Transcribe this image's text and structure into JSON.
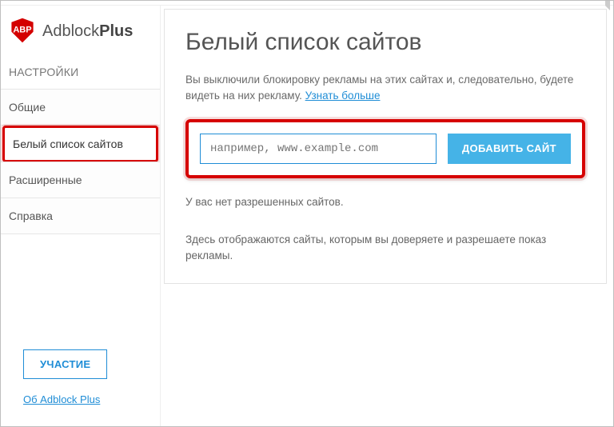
{
  "brand": {
    "name_light": "Adblock",
    "name_bold": "Plus"
  },
  "sidebar": {
    "header": "НАСТРОЙКИ",
    "items": [
      {
        "label": "Общие"
      },
      {
        "label": "Белый список сайтов"
      },
      {
        "label": "Расширенные"
      },
      {
        "label": "Справка"
      }
    ],
    "contribute_label": "УЧАСТИЕ",
    "about_label": "Об Adblock Plus"
  },
  "main": {
    "title": "Белый список сайтов",
    "description_prefix": "Вы выключили блокировку рекламы на этих сайтах и, следовательно, будете видеть на них рекламу. ",
    "learn_more": "Узнать больше",
    "input_placeholder": "например, www.example.com",
    "add_button": "ДОБАВИТЬ САЙТ",
    "empty_msg": "У вас нет разрешенных сайтов.",
    "note": "Здесь отображаются сайты, которым вы доверяете и разрешаете показ рекламы."
  }
}
